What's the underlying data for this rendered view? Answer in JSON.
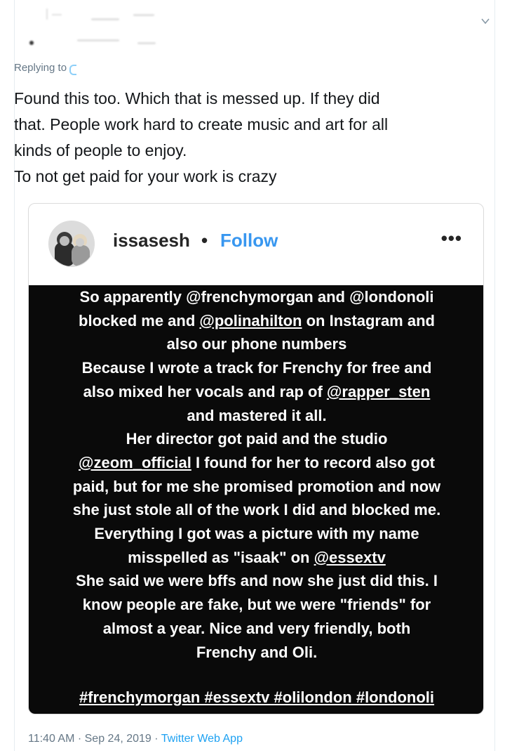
{
  "tweet": {
    "replying_label": "Replying to",
    "text_lines": [
      "Found this too. Which that is messed up. If they did",
      "that. People work hard to create music and art for all",
      "kinds of people to enjoy.",
      "To not get paid for your work is crazy"
    ],
    "timestamp": "11:40 AM · Sep 24, 2019 ·",
    "source_app": "Twitter Web App"
  },
  "embed": {
    "username": "issasesh",
    "separator": "•",
    "follow_label": "Follow",
    "more_label": "•••",
    "story_lines": [
      [
        {
          "t": "So apparently "
        },
        {
          "t": "@frenchymorgan",
          "m": false
        },
        {
          "t": " and "
        },
        {
          "t": "@londonoli",
          "m": false
        }
      ],
      [
        {
          "t": "blocked me and "
        },
        {
          "t": "@polinahilton",
          "m": true
        },
        {
          "t": " on Instagram and"
        }
      ],
      [
        {
          "t": "also our phone numbers"
        }
      ],
      [
        {
          "t": "Because I wrote a track for Frenchy for free and"
        }
      ],
      [
        {
          "t": "also mixed her vocals and rap of  "
        },
        {
          "t": "@rapper_sten",
          "m": true
        }
      ],
      [
        {
          "t": "and mastered it all."
        }
      ],
      [
        {
          "t": "Her director got paid and the studio"
        }
      ],
      [
        {
          "t": "@zeom_official",
          "m": true
        },
        {
          "t": " I found for her to record  also got"
        }
      ],
      [
        {
          "t": "paid, but for me she promised promotion and now"
        }
      ],
      [
        {
          "t": "she just stole all of the work I did and blocked me."
        }
      ],
      [
        {
          "t": "Everything I got was a picture with my name"
        }
      ],
      [
        {
          "t": "misspelled as \"isaak\" on "
        },
        {
          "t": "@essextv",
          "m": true
        }
      ],
      [
        {
          "t": "She said we were bffs and now she just did this. I"
        }
      ],
      [
        {
          "t": "know people are fake, but we were \"friends\" for"
        }
      ],
      [
        {
          "t": "almost a year. Nice and very friendly, both"
        }
      ],
      [
        {
          "t": "Frenchy and Oli."
        }
      ]
    ],
    "hashtags": "#frenchymorgan #essextv #olilondon #londonoli"
  },
  "colors": {
    "twitter_blue": "#1da1f2",
    "instagram_blue": "#3897f0",
    "story_bg": "#0a0a0a",
    "meta_gray": "#657786"
  },
  "icons": {
    "caret": "chevron-down-icon",
    "more": "more-options-icon"
  }
}
